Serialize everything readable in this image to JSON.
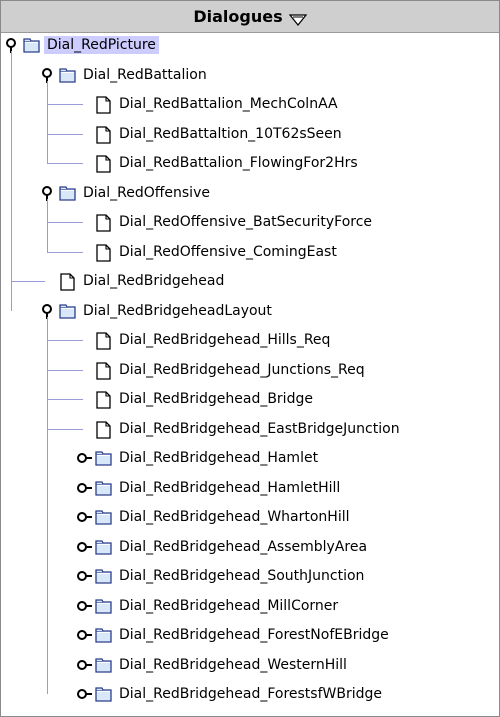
{
  "panel": {
    "title": "Dialogues",
    "menu_icon": "triangle-down-icon"
  },
  "tree": {
    "root": {
      "label": "Dial_RedPicture",
      "expanded": true,
      "selected": true,
      "type": "folder"
    },
    "items": [
      {
        "label": "Dial_RedBattalion",
        "type": "folder",
        "expanded": true,
        "level": 1
      },
      {
        "label": "Dial_RedBattalion_MechColnAA",
        "type": "file",
        "level": 2
      },
      {
        "label": "Dial_RedBattaltion_10T62sSeen",
        "type": "file",
        "level": 2
      },
      {
        "label": "Dial_RedBattalion_FlowingFor2Hrs",
        "type": "file",
        "level": 2
      },
      {
        "label": "Dial_RedOffensive",
        "type": "folder",
        "expanded": true,
        "level": 1
      },
      {
        "label": "Dial_RedOffensive_BatSecurityForce",
        "type": "file",
        "level": 2
      },
      {
        "label": "Dial_RedOffensive_ComingEast",
        "type": "file",
        "level": 2
      },
      {
        "label": "Dial_RedBridgehead",
        "type": "file",
        "level": 1
      },
      {
        "label": "Dial_RedBridgeheadLayout",
        "type": "folder",
        "expanded": true,
        "level": 1
      },
      {
        "label": "Dial_RedBridgehead_Hills_Req",
        "type": "file",
        "level": 2
      },
      {
        "label": "Dial_RedBridgehead_Junctions_Req",
        "type": "file",
        "level": 2
      },
      {
        "label": "Dial_RedBridgehead_Bridge",
        "type": "file",
        "level": 2
      },
      {
        "label": "Dial_RedBridgehead_EastBridgeJunction",
        "type": "file",
        "level": 2
      },
      {
        "label": "Dial_RedBridgehead_Hamlet",
        "type": "folder",
        "expanded": false,
        "level": 2
      },
      {
        "label": "Dial_RedBridgehead_HamletHill",
        "type": "folder",
        "expanded": false,
        "level": 2
      },
      {
        "label": "Dial_RedBridgehead_WhartonHill",
        "type": "folder",
        "expanded": false,
        "level": 2
      },
      {
        "label": "Dial_RedBridgehead_AssemblyArea",
        "type": "folder",
        "expanded": false,
        "level": 2
      },
      {
        "label": "Dial_RedBridgehead_SouthJunction",
        "type": "folder",
        "expanded": false,
        "level": 2
      },
      {
        "label": "Dial_RedBridgehead_MillCorner",
        "type": "folder",
        "expanded": false,
        "level": 2
      },
      {
        "label": "Dial_RedBridgehead_ForestNofEBridge",
        "type": "folder",
        "expanded": false,
        "level": 2
      },
      {
        "label": "Dial_RedBridgehead_WesternHill",
        "type": "folder",
        "expanded": false,
        "level": 2
      },
      {
        "label": "Dial_RedBridgehead_ForestsfWBridge",
        "type": "folder",
        "expanded": false,
        "level": 2
      }
    ]
  },
  "colors": {
    "header_bg": "#cfcfcf",
    "selection": "#ccccff",
    "tree_lines": "#9a9ad8",
    "folder_fill": "#d8e8f8",
    "folder_stroke": "#2c3e8c"
  }
}
